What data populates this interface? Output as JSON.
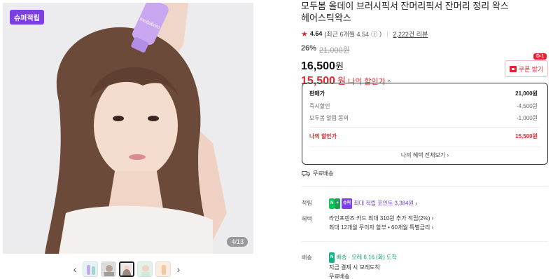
{
  "gallery": {
    "badge": "슈퍼적립",
    "counter": "4/13",
    "prev_icon": "chevron-left-icon",
    "next_icon": "chevron-right-icon",
    "thumb_count": 5,
    "active_thumb": 3
  },
  "product": {
    "title_line1": "모두봄 올데이 브러시픽서 잔머리픽서 잔머리 정리 왁스",
    "title_line2": "헤어스틱왁스",
    "rating": "4.64",
    "rating_recent": "(최근 6개월 4.54",
    "info_icon": "info-icon",
    "rating_recent_close": ")",
    "review_count": "2,222건 리뷰",
    "discount_pct": "26%",
    "original_price": "21,000원",
    "sale_price": "16,500",
    "won": "원",
    "my_price": "15,500",
    "my_price_label": "나의 할인가"
  },
  "coupon": {
    "dday": "D-1",
    "label": "쿠폰 받기"
  },
  "price_box": {
    "rows": [
      {
        "label": "판매가",
        "value": "21,000원"
      },
      {
        "label": "즉시할인",
        "value": "-4,500원"
      },
      {
        "label": "모두봄 알림 동의",
        "value": "-1,000원"
      },
      {
        "label": "나의 할인가",
        "value": "15,500원"
      }
    ],
    "more": "나의 혜택 전체보기"
  },
  "shipping_free": "무료배송",
  "points": {
    "label": "적립",
    "npay": "N",
    "plus": "+",
    "super": "슈퍼",
    "text": "최대 적립 포인트 3,384원"
  },
  "benefits": {
    "label": "혜택",
    "line1": "라인프렌즈 카드 최대 310원 추가 적립(2%)",
    "line2": "최대 12개월 무이자 할부 • 60개월 특별금리"
  },
  "delivery": {
    "label": "배송",
    "tag": "N",
    "tag_text": "배송",
    "eta": "· 모레 6.16 (화) 도착",
    "line2": "지금 결제 시 모레도착",
    "line3": "무료배송"
  },
  "colors": {
    "accent_red": "#e8252f",
    "super_purple": "#7b3fe4",
    "npay_green": "#03c75a"
  }
}
